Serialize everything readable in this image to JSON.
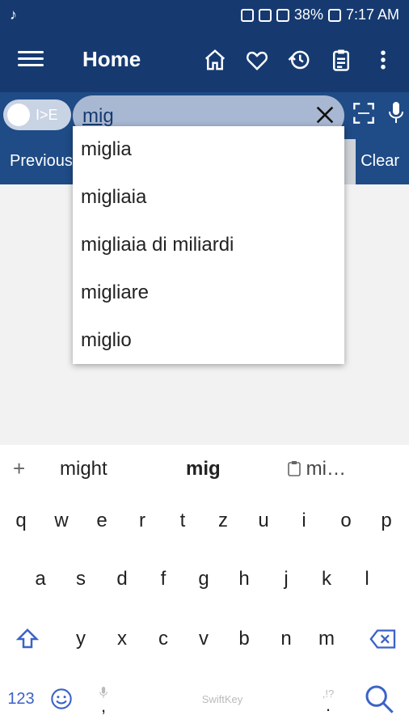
{
  "status_bar": {
    "battery": "38%",
    "time": "7:17 AM"
  },
  "app_bar": {
    "title": "Home"
  },
  "search": {
    "toggle_label": "I>E",
    "query": "mig"
  },
  "nav": {
    "previous": "Previous",
    "clear": "Clear"
  },
  "suggestions_dropdown": [
    "miglia",
    "migliaia",
    "migliaia di miliardi",
    "migliare",
    "miglio"
  ],
  "keyboard": {
    "suggestions": [
      "+",
      "might",
      "mig",
      "mi…"
    ],
    "row1": [
      "q",
      "w",
      "e",
      "r",
      "t",
      "z",
      "u",
      "i",
      "o",
      "p"
    ],
    "row2": [
      "a",
      "s",
      "d",
      "f",
      "g",
      "h",
      "j",
      "k",
      "l"
    ],
    "row3": [
      "y",
      "x",
      "c",
      "v",
      "b",
      "n",
      "m"
    ],
    "bottom": {
      "num": "123",
      "brand": "SwiftKey",
      "comma": ",",
      "period": "."
    }
  },
  "icons": {
    "app_bar": [
      "home-icon",
      "heart-icon",
      "history-icon",
      "clipboard-icon",
      "more-vert-icon"
    ],
    "search": [
      "close-icon",
      "ocr-icon",
      "mic-icon"
    ]
  },
  "colors": {
    "primary": "#163a70",
    "secondary": "#1f4b86",
    "accent": "#3b63c6"
  }
}
